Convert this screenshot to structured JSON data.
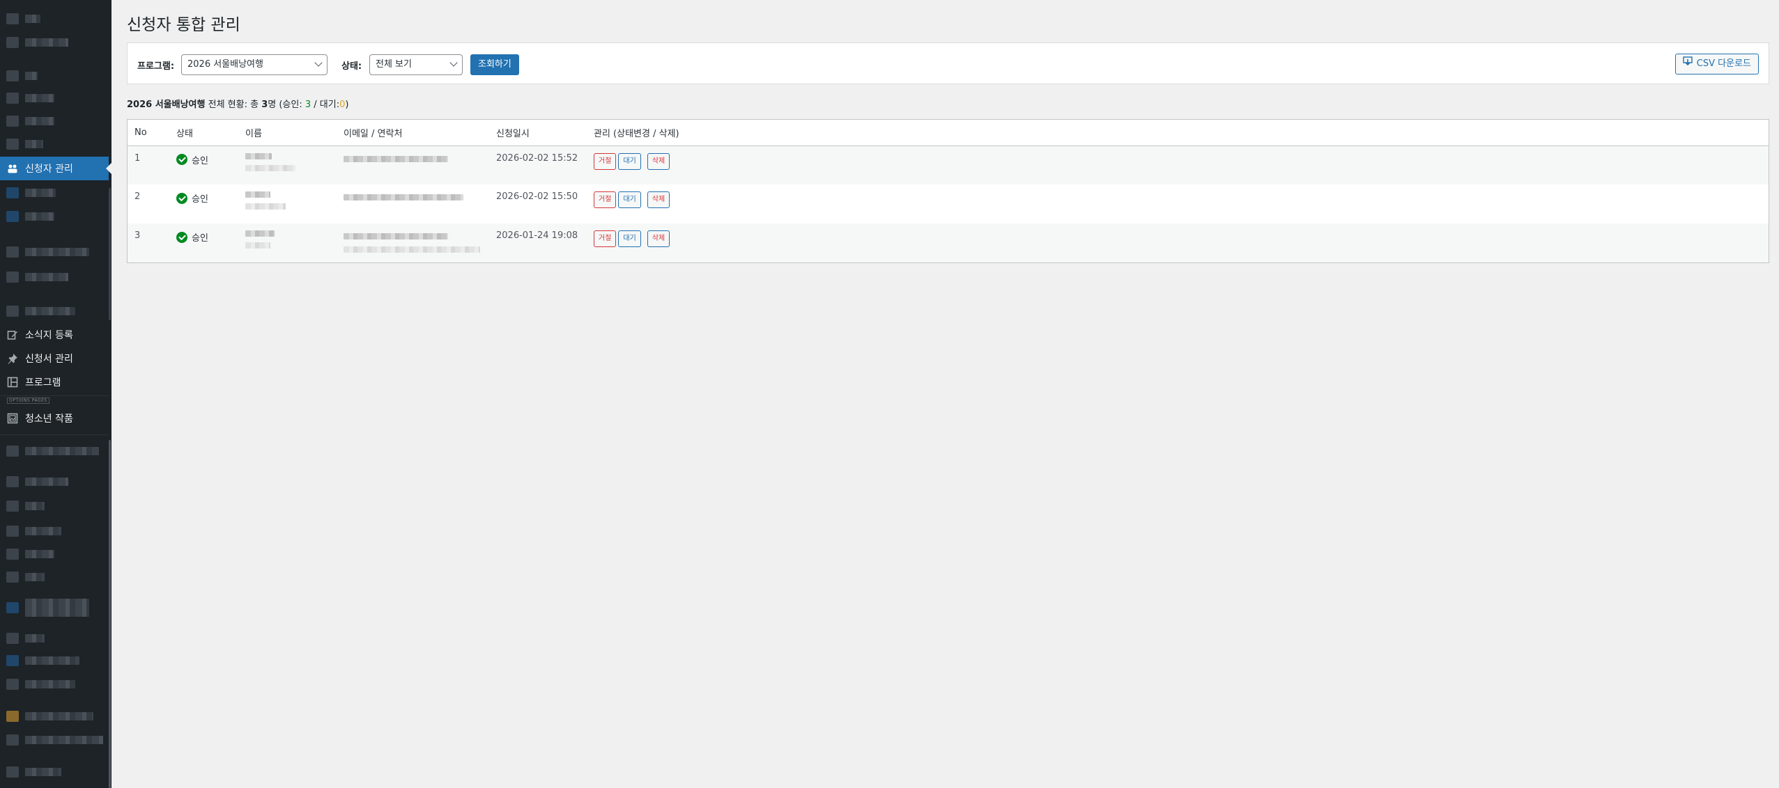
{
  "sidebar": {
    "items": [
      {
        "id": "applicants",
        "label": "신청자 관리",
        "icon": "group-icon",
        "active": true
      },
      {
        "id": "news",
        "label": "소식지 등록",
        "icon": "edit-icon"
      },
      {
        "id": "forms",
        "label": "신청서 관리",
        "icon": "pin-icon"
      },
      {
        "id": "programs",
        "label": "프로그램",
        "icon": "layout-icon"
      },
      {
        "id": "youth",
        "label": "청소년 작품",
        "icon": "gallery-icon"
      }
    ],
    "options_label": "OPTIONS PAGES"
  },
  "page": {
    "title": "신청자 통합 관리"
  },
  "filter": {
    "program_label": "프로그램:",
    "program_value": "2026 서울배낭여행",
    "status_label": "상태:",
    "status_value": "전체 보기",
    "search_button": "조회하기",
    "csv_button": "CSV 다운로드"
  },
  "summary": {
    "program": "2026 서울배낭여행",
    "text_prefix": "전체 현황: 총",
    "total": "3",
    "unit": "명",
    "approved_label": "(승인:",
    "approved": "3",
    "pending_label": "/ 대기:",
    "pending": "0",
    "close": ")"
  },
  "table": {
    "headers": {
      "no": "No",
      "status": "상태",
      "name": "이름",
      "contact": "이메일 / 연락처",
      "date": "신청일시",
      "manage": "관리 (상태변경 / 삭제)"
    },
    "rows": [
      {
        "no": "1",
        "status": "승인",
        "date": "2026-02-02 15:52"
      },
      {
        "no": "2",
        "status": "승인",
        "date": "2026-02-02 15:50"
      },
      {
        "no": "3",
        "status": "승인",
        "date": "2026-01-24 19:08"
      }
    ],
    "actions": {
      "reject": "거절",
      "wait": "대기",
      "delete": "삭제"
    }
  },
  "colors": {
    "sidebar_bg": "#1d2327",
    "accent": "#2271b1",
    "approved_green": "#008a20",
    "pending_orange": "#dba617",
    "danger_red": "#d63638"
  }
}
